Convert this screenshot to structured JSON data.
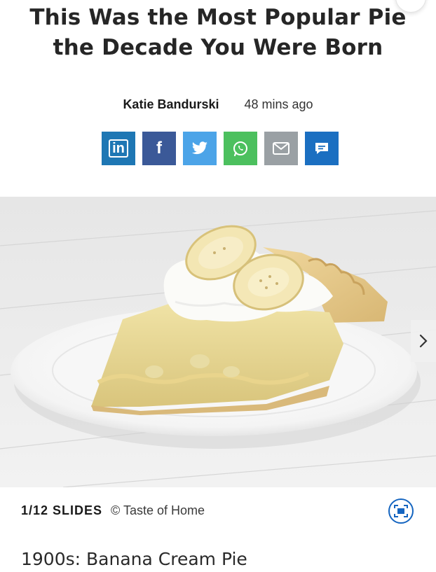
{
  "article": {
    "headline": "This Was the Most Popular Pie the Decade You Were Born",
    "author": "Katie Bandurski",
    "time_ago": "48 mins ago"
  },
  "share_buttons": [
    {
      "name": "linkedin-share-button",
      "icon": "linkedin-icon",
      "glyph": "in",
      "color": "#1e77b4"
    },
    {
      "name": "facebook-share-button",
      "icon": "facebook-icon",
      "glyph": "f",
      "color": "#3b5998"
    },
    {
      "name": "twitter-share-button",
      "icon": "twitter-icon",
      "glyph": "",
      "color": "#4ca4e8"
    },
    {
      "name": "whatsapp-share-button",
      "icon": "whatsapp-icon",
      "glyph": "",
      "color": "#4cc05e"
    },
    {
      "name": "email-share-button",
      "icon": "email-icon",
      "glyph": "",
      "color": "#9aa0a4"
    },
    {
      "name": "comments-button",
      "icon": "comment-icon",
      "glyph": "",
      "color": "#1b6fc1"
    }
  ],
  "slideshow": {
    "slide_counter": "1/12 SLIDES",
    "credit": "© Taste of Home",
    "slide_title": "1900s: Banana Cream Pie"
  }
}
